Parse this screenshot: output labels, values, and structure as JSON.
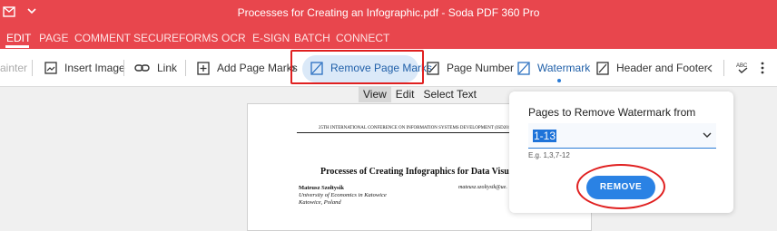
{
  "titlebar": {
    "title": "Processes for Creating an Infographic.pdf - Soda PDF 360 Pro"
  },
  "menu": [
    "EDIT",
    "PAGE",
    "COMMENT",
    "SECURE",
    "FORMS",
    "OCR",
    "E-SIGN",
    "BATCH",
    "CONNECT"
  ],
  "toolbar": {
    "painter_partial": "ainter",
    "insert_image": "Insert Image",
    "link": "Link",
    "add_page_marks": "Add Page Marks",
    "remove_page_marks": "Remove Page Marks",
    "page_number": "Page Number",
    "watermark": "Watermark",
    "header_footer": "Header and Footer"
  },
  "view_tabs": [
    "View",
    "Edit",
    "Select Text"
  ],
  "document": {
    "header": "25TH INTERNATIONAL CONFERENCE ON INFORMATION SYSTEMS DEVELOPMENT (ISD2016 POLA",
    "title": "Processes of Creating Infographics for Data Visualization",
    "author": "Mateusz Szołtysik",
    "email": "mateusz.szoltysik@ue.",
    "affiliation": "University of Economics in Katowice",
    "location": "Katowice, Poland"
  },
  "panel": {
    "label": "Pages to Remove Watermark from",
    "value": "1-13",
    "hint": "E.g. 1,3,7-12",
    "button": "REMOVE"
  },
  "colors": {
    "brand": "#e8464d",
    "accent": "#2a82e4",
    "highlight": "#e02020"
  }
}
